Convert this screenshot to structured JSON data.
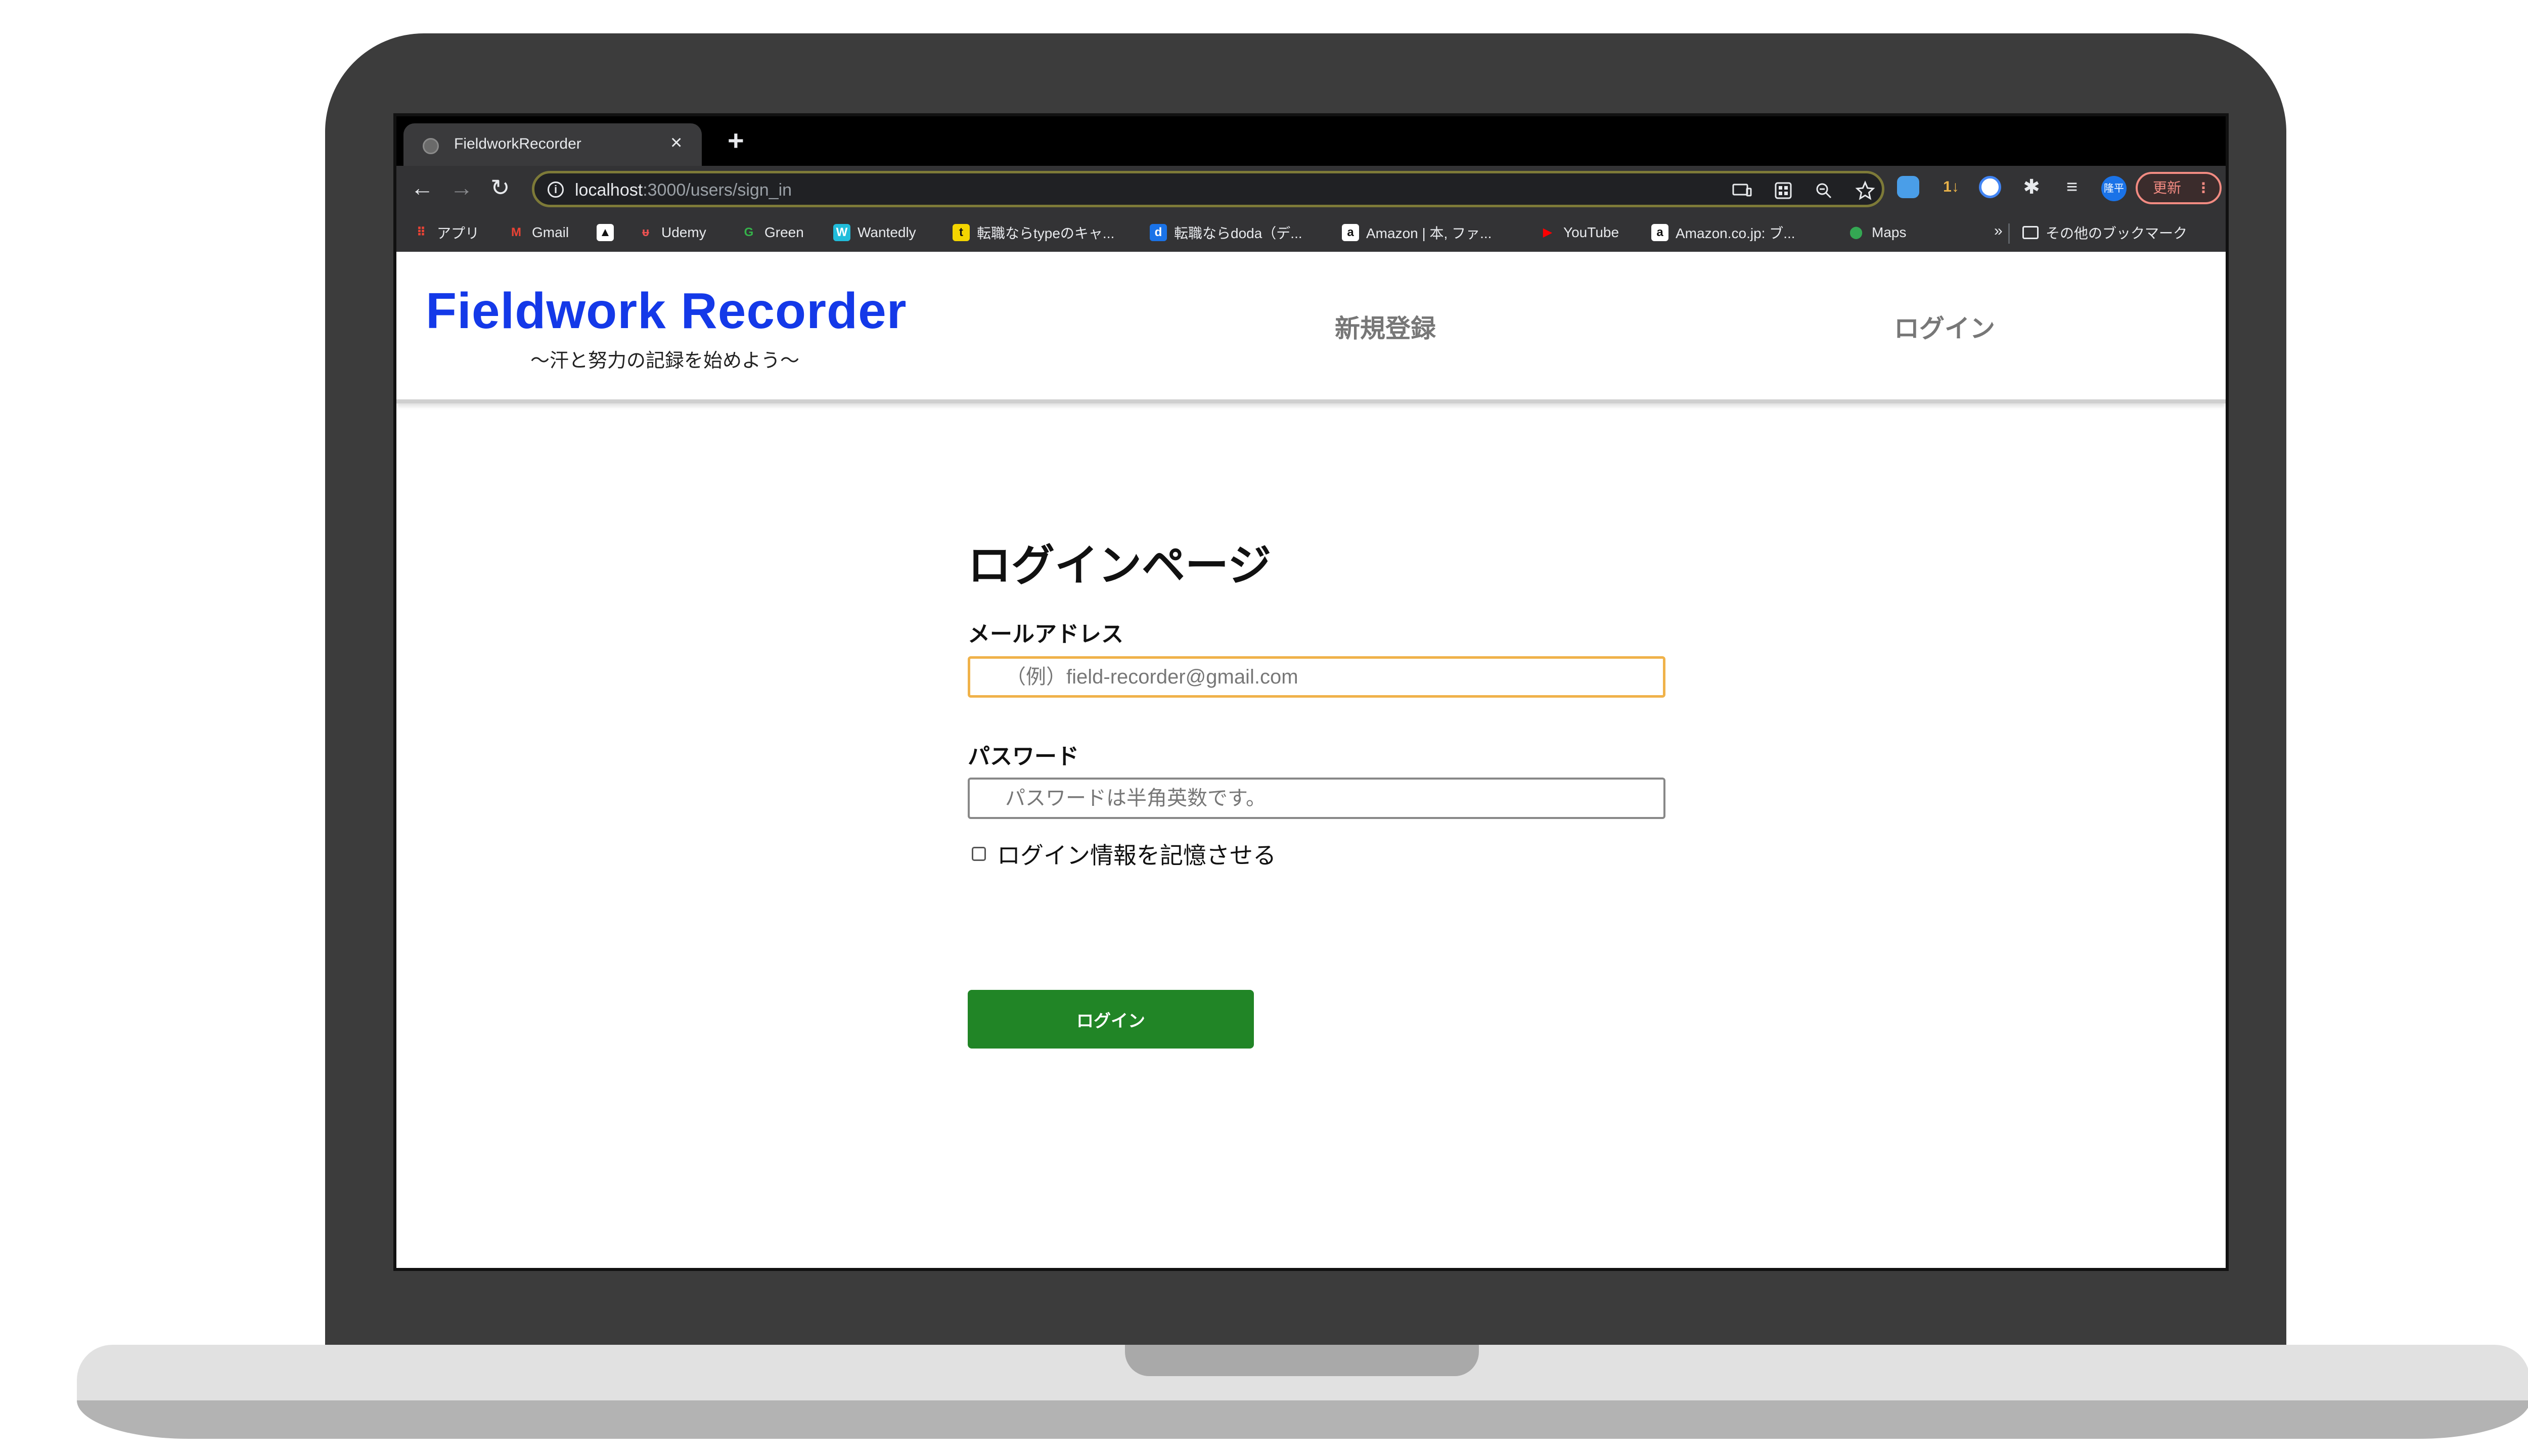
{
  "browser": {
    "tab": {
      "title": "FieldworkRecorder",
      "close": "×"
    },
    "new_tab": "+",
    "nav": {
      "back": "←",
      "forward": "→",
      "reload": "↻"
    },
    "url": {
      "host": "localhost",
      "rest": ":3000/users/sign_in"
    },
    "ext_rank_label": "1↓",
    "avatar_label": "隆平",
    "update_button": {
      "label": "更新",
      "menu": "⋮"
    },
    "bookmarks": [
      {
        "label": "アプリ",
        "icon": "apps-grid-icon",
        "color": "#ea4335"
      },
      {
        "label": "Gmail",
        "icon": "gmail-icon",
        "color": "#ea4335"
      },
      {
        "label": "",
        "icon": "triangle-app-icon",
        "color": "#ffffff"
      },
      {
        "label": "Udemy",
        "icon": "udemy-icon",
        "color": "#ec5252"
      },
      {
        "label": "Green",
        "icon": "green-icon",
        "color": "#35b34a"
      },
      {
        "label": "Wantedly",
        "icon": "wantedly-icon",
        "color": "#21bddb"
      },
      {
        "label": "転職ならtypeのキャ...",
        "icon": "type-icon",
        "color": "#f4d500"
      },
      {
        "label": "転職ならdoda（デ...",
        "icon": "doda-icon",
        "color": "#1a73e8"
      },
      {
        "label": "Amazon | 本, ファ...",
        "icon": "amazon-icon",
        "color": "#ffffff"
      },
      {
        "label": "YouTube",
        "icon": "youtube-icon",
        "color": "#ff0000"
      },
      {
        "label": "Amazon.co.jp: ブ...",
        "icon": "amazon-icon",
        "color": "#ffffff"
      },
      {
        "label": "Maps",
        "icon": "maps-icon",
        "color": "#34a853"
      }
    ],
    "bookmarks_more": "»",
    "other_bookmarks": "その他のブックマーク"
  },
  "site": {
    "logo": "Fieldwork Recorder",
    "tagline": "〜汗と努力の記録を始めよう〜",
    "nav": {
      "signup": "新規登録",
      "login": "ログイン"
    }
  },
  "form": {
    "title": "ログインページ",
    "email_label": "メールアドレス",
    "email_placeholder": "（例）field-recorder@gmail.com",
    "password_label": "パスワード",
    "password_placeholder": "パスワードは半角英数です。",
    "remember_label": "ログイン情報を記憶させる",
    "submit_label": "ログイン"
  },
  "colors": {
    "brand_blue": "#1439e8",
    "submit_green": "#218526",
    "email_focus_border": "#f0b24a"
  }
}
